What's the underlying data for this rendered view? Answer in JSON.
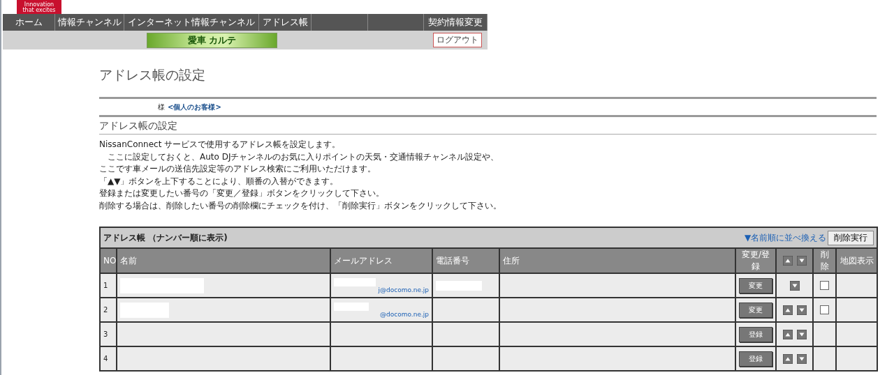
{
  "logo": {
    "lines": [
      "Innovation",
      "that excites"
    ]
  },
  "nav": {
    "items": [
      {
        "kind": "link",
        "label": "ホーム"
      },
      {
        "kind": "link",
        "label": "情報チャンネル"
      },
      {
        "kind": "link",
        "label": "インターネット情報チャンネル"
      },
      {
        "kind": "link",
        "label": "アドレス帳"
      },
      {
        "kind": "spacer"
      },
      {
        "kind": "spacer"
      },
      {
        "kind": "link",
        "label": "契約情報変更"
      }
    ]
  },
  "banner": {
    "text": "愛車 カルテ"
  },
  "logout_button": "ログアウト",
  "page_title": "アドレス帳の設定",
  "customer": {
    "honorific": "様",
    "category": "<個人のお客様>"
  },
  "section_title": "アドレス帳の設定",
  "description": [
    "NissanConnect サービスで使用するアドレス帳を設定します。",
    "　ここに設定しておくと、Auto DJチャンネルのお気に入りポイントの天気・交通情報チャンネル設定や、",
    "ここです車メールの送信先設定等のアドレス検索にご利用いただけます。",
    "「▲▼」ボタンを上下することにより、順番の入替ができます。",
    "登録または変更したい番号の「変更／登録」ボタンをクリックして下さい。",
    "削除する場合は、削除したい番号の削除欄にチェックを付け、「削除実行」ボタンをクリックして下さい。"
  ],
  "table": {
    "title": "アドレス帳 （ナンバー順に表示)",
    "sort_link": "▼名前順に並べ換える",
    "delete_button": "削除実行",
    "columns": [
      {
        "kind": "text",
        "label": "NO"
      },
      {
        "kind": "text",
        "label": "名前"
      },
      {
        "kind": "text",
        "label": "メールアドレス"
      },
      {
        "kind": "text",
        "label": "電話番号"
      },
      {
        "kind": "text",
        "label": "住所"
      },
      {
        "kind": "text",
        "label": "変更/登録"
      },
      {
        "kind": "arrows"
      },
      {
        "kind": "text",
        "label": "削除"
      },
      {
        "kind": "text",
        "label": "地図表示"
      }
    ],
    "rows": [
      {
        "no": "1",
        "name_redacted": true,
        "email": "j@docomo.ne.jp",
        "email_redacted": true,
        "phone_redacted": true,
        "action": "変更",
        "can_move_up": false,
        "can_move_down": true,
        "checked": false
      },
      {
        "no": "2",
        "name_redacted": true,
        "email": "@docomo.ne.jp",
        "email_redacted": true,
        "phone_redacted": false,
        "action": "変更",
        "can_move_up": true,
        "can_move_down": true,
        "checked": false
      },
      {
        "no": "3",
        "name_redacted": false,
        "email_redacted": false,
        "phone_redacted": false,
        "action": "登録",
        "can_move_up": true,
        "can_move_down": true
      },
      {
        "no": "4",
        "name_redacted": false,
        "email_redacted": false,
        "phone_redacted": false,
        "action": "登録",
        "can_move_up": true,
        "can_move_down": true
      }
    ]
  }
}
